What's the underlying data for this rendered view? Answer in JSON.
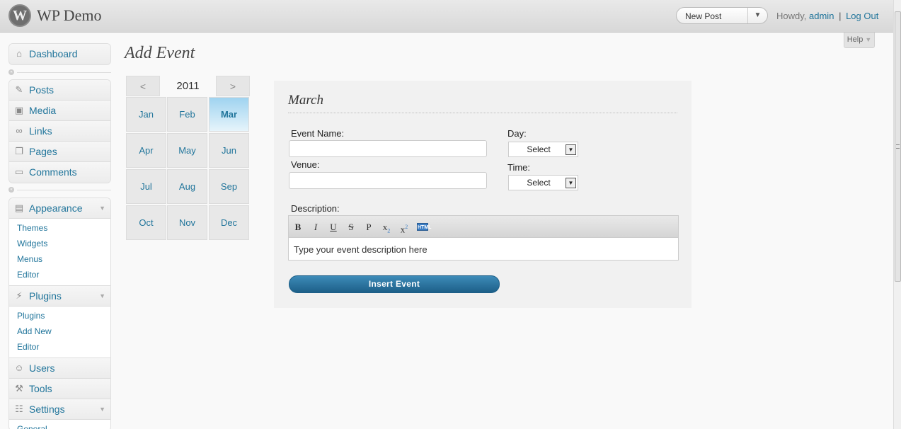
{
  "header": {
    "logo_glyph": "W",
    "site_title": "WP Demo",
    "new_post_label": "New Post",
    "new_post_arrow": "▼",
    "howdy": "Howdy,",
    "username": "admin",
    "separator": "|",
    "logout": "Log Out",
    "help": "Help",
    "help_caret": "▼"
  },
  "sidebar": {
    "dashboard": {
      "label": "Dashboard",
      "icon": "home-icon"
    },
    "content_items": [
      {
        "label": "Posts",
        "icon": "pin-icon"
      },
      {
        "label": "Media",
        "icon": "media-icon"
      },
      {
        "label": "Links",
        "icon": "link-icon"
      },
      {
        "label": "Pages",
        "icon": "pages-icon"
      },
      {
        "label": "Comments",
        "icon": "comments-icon"
      }
    ],
    "appearance": {
      "label": "Appearance",
      "icon": "appearance-icon",
      "subitems": [
        "Themes",
        "Widgets",
        "Menus",
        "Editor"
      ]
    },
    "plugins": {
      "label": "Plugins",
      "icon": "plugin-icon",
      "subitems": [
        "Plugins",
        "Add New",
        "Editor"
      ]
    },
    "users": {
      "label": "Users",
      "icon": "users-icon"
    },
    "tools": {
      "label": "Tools",
      "icon": "tools-icon"
    },
    "settings": {
      "label": "Settings",
      "icon": "settings-icon",
      "subitems": [
        "General"
      ]
    },
    "toggle_glyph": "▼",
    "collapse_glyph": "«"
  },
  "page": {
    "title": "Add Event"
  },
  "calendar": {
    "year": "2011",
    "prev": "<",
    "next": ">",
    "months": [
      "Jan",
      "Feb",
      "Mar",
      "Apr",
      "May",
      "Jun",
      "Jul",
      "Aug",
      "Sep",
      "Oct",
      "Nov",
      "Dec"
    ],
    "selected": "Mar"
  },
  "event_form": {
    "month_title": "March",
    "event_name_label": "Event Name:",
    "event_name_value": "",
    "venue_label": "Venue:",
    "venue_value": "",
    "day_label": "Day:",
    "day_value": "Select",
    "time_label": "Time:",
    "time_value": "Select",
    "description_label": "Description:",
    "description_placeholder": "Type your event description here",
    "toolbar": {
      "bold": "B",
      "italic": "I",
      "underline": "U",
      "strikethrough": "S",
      "paragraph": "P",
      "subscript": "x",
      "subscript_mark": "2",
      "superscript": "x",
      "superscript_mark": "2",
      "html": "HTML"
    },
    "insert_button": "Insert  Event",
    "select_arrow": "▼"
  },
  "colors": {
    "link": "#21759b",
    "button": "#1d5f88",
    "selected_month": "#9fd3f0"
  }
}
